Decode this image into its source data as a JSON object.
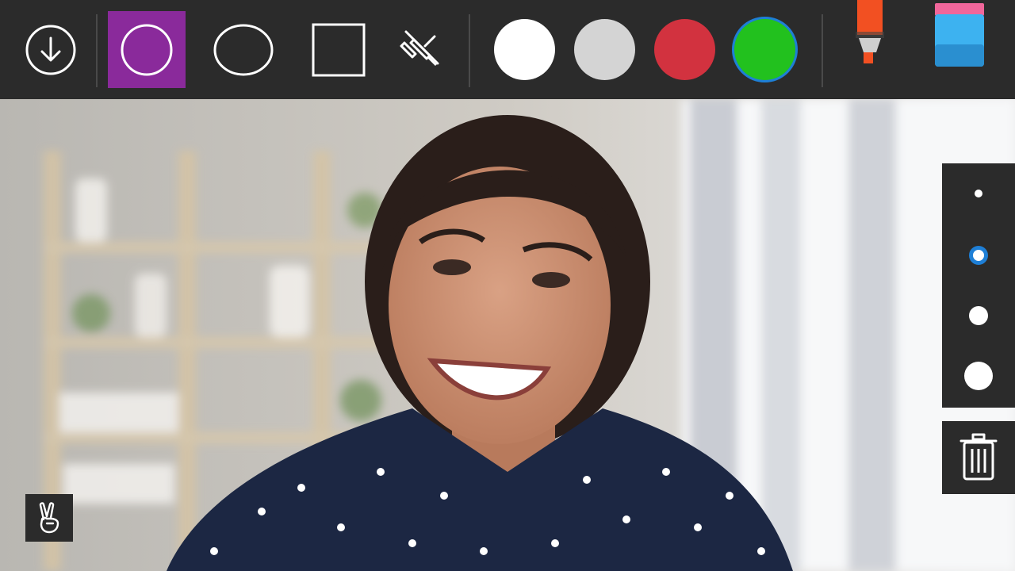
{
  "toolbar": {
    "tools": [
      {
        "name": "save-download",
        "icon": "download-circle-icon",
        "selected": false
      },
      {
        "name": "circle-shape",
        "icon": "circle-outline-icon",
        "selected": true
      },
      {
        "name": "ellipse-shape",
        "icon": "ellipse-outline-icon",
        "selected": false
      },
      {
        "name": "rectangle-shape",
        "icon": "square-outline-icon",
        "selected": false
      },
      {
        "name": "pen-off",
        "icon": "pen-crossed-out-icon",
        "selected": false
      }
    ],
    "selected_tool_color": "#8a2a9b",
    "colors": [
      {
        "name": "white",
        "hex": "#ffffff",
        "selected": false
      },
      {
        "name": "light-gray",
        "hex": "#d4d4d4",
        "selected": false
      },
      {
        "name": "red",
        "hex": "#d2323f",
        "selected": false
      },
      {
        "name": "green",
        "hex": "#22c11e",
        "selected": true
      }
    ],
    "selection_ring_color": "#1e7fd6",
    "marker": {
      "icon": "marker-icon",
      "tip_color": "#f25022"
    },
    "eraser": {
      "icon": "eraser-icon",
      "top_color": "#f0669a",
      "body_color": "#3db2f0"
    }
  },
  "stroke_sizes": {
    "options": [
      "extra-small",
      "small",
      "medium",
      "large"
    ],
    "selected": "small",
    "accent": "#1e7fd6"
  },
  "actions": {
    "clear_icon": "trash-icon",
    "gesture_icon": "victory-hand-icon"
  }
}
